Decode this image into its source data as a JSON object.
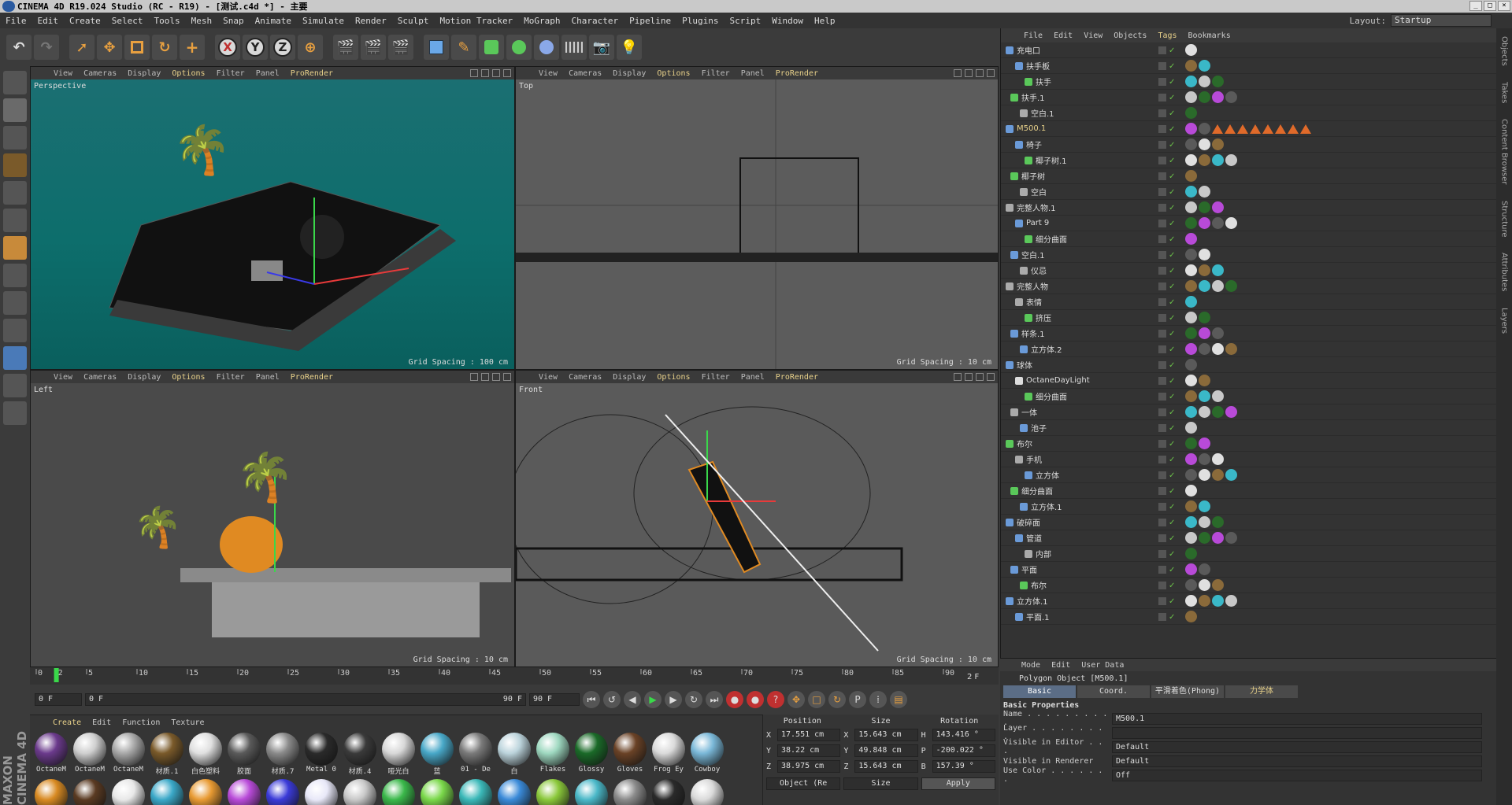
{
  "titlebar": {
    "title": "CINEMA 4D R19.024 Studio (RC - R19) - [测试.c4d *] - 主要"
  },
  "menubar": {
    "items": [
      "File",
      "Edit",
      "Create",
      "Select",
      "Tools",
      "Mesh",
      "Snap",
      "Animate",
      "Simulate",
      "Render",
      "Sculpt",
      "Motion Tracker",
      "MoGraph",
      "Character",
      "Pipeline",
      "Plugins",
      "Script",
      "Window",
      "Help"
    ],
    "layout_label": "Layout:",
    "layout_value": "Startup"
  },
  "viewport_menu": {
    "view": "View",
    "cameras": "Cameras",
    "display": "Display",
    "options": "Options",
    "filter": "Filter",
    "panel": "Panel",
    "prorender": "ProRender"
  },
  "viewports": {
    "perspective": {
      "name": "Perspective",
      "grid": "Grid Spacing : 100 cm"
    },
    "top": {
      "name": "Top",
      "grid": "Grid Spacing : 10 cm"
    },
    "left": {
      "name": "Left",
      "grid": "Grid Spacing : 10 cm"
    },
    "front": {
      "name": "Front",
      "grid": "Grid Spacing : 10 cm"
    }
  },
  "timeline": {
    "ticks": [
      "0",
      "2",
      "5",
      "10",
      "15",
      "20",
      "25",
      "30",
      "35",
      "40",
      "45",
      "50",
      "55",
      "60",
      "65",
      "70",
      "75",
      "80",
      "85",
      "90"
    ],
    "current": "2 F",
    "start": "0 F",
    "range_start": "0 F",
    "range_end": "90 F",
    "end": "90 F"
  },
  "materials": {
    "menu": {
      "create": "Create",
      "edit": "Edit",
      "function": "Function",
      "texture": "Texture"
    },
    "items": [
      {
        "name": "OctaneM",
        "color": "#6b3a8c"
      },
      {
        "name": "OctaneM",
        "color": "#cfcfcf"
      },
      {
        "name": "OctaneM",
        "color": "#a8a8a8"
      },
      {
        "name": "材质.1",
        "color": "#7a5a2a"
      },
      {
        "name": "白色塑料",
        "color": "#e0e0e0"
      },
      {
        "name": "胶面",
        "color": "#5a5a5a"
      },
      {
        "name": "材质.7",
        "color": "#8a8a8a"
      },
      {
        "name": "Metal 0",
        "color": "#2a2a2a"
      },
      {
        "name": "材质.4",
        "color": "#3a3a3a"
      },
      {
        "name": "哑光白",
        "color": "#d8d8d8"
      },
      {
        "name": "蓝",
        "color": "#48a8c8"
      },
      {
        "name": "01 - De",
        "color": "#7a7a7a"
      },
      {
        "name": "白",
        "color": "#bcd4dc"
      },
      {
        "name": "Flakes",
        "color": "#9ed8c0"
      },
      {
        "name": "Glossy",
        "color": "#1a6a28"
      },
      {
        "name": "Gloves",
        "color": "#6a4226"
      },
      {
        "name": "Frog Ey",
        "color": "#dadada"
      },
      {
        "name": "Cowboy",
        "color": "#7ab8d8"
      },
      {
        "name": "",
        "color": "#d88a22"
      },
      {
        "name": "",
        "color": "#5a3a22"
      },
      {
        "name": "",
        "color": "#e8e8e8"
      },
      {
        "name": "",
        "color": "#3aa8c8"
      },
      {
        "name": "",
        "color": "#e89a32"
      },
      {
        "name": "",
        "color": "#b84ad8"
      },
      {
        "name": "",
        "color": "#3a3ad8"
      },
      {
        "name": "",
        "color": "#e8e8f8"
      },
      {
        "name": "",
        "color": "#c8c8c8"
      },
      {
        "name": "",
        "color": "#3ab84a"
      },
      {
        "name": "",
        "color": "#7ad84a"
      },
      {
        "name": "",
        "color": "#3ab8b8"
      },
      {
        "name": "",
        "color": "#3a8ad8"
      },
      {
        "name": "",
        "color": "#8ac83a"
      },
      {
        "name": "",
        "color": "#4ab8c8"
      },
      {
        "name": "",
        "color": "#8a8a8a"
      },
      {
        "name": "",
        "color": "#2a2a2a"
      },
      {
        "name": "",
        "color": "#dadada"
      }
    ]
  },
  "coords": {
    "h_pos": "Position",
    "h_size": "Size",
    "h_rot": "Rotation",
    "x": {
      "label": "X",
      "pos": "17.551 cm",
      "size_label": "X",
      "size": "15.643 cm",
      "rot_label": "H",
      "rot": "143.416 °"
    },
    "y": {
      "label": "Y",
      "pos": "38.22 cm",
      "size_label": "Y",
      "size": "49.848 cm",
      "rot_label": "P",
      "rot": "-200.022 °"
    },
    "z": {
      "label": "Z",
      "pos": "38.975 cm",
      "size_label": "Z",
      "size": "15.643 cm",
      "rot_label": "B",
      "rot": "157.39 °"
    },
    "mode": "Object (Re",
    "size_mode": "Size",
    "apply": "Apply"
  },
  "objects": {
    "menu": [
      "File",
      "Edit",
      "View",
      "Objects",
      "Tags",
      "Bookmarks"
    ],
    "rows": [
      {
        "name": "充电口",
        "icon": "#6a9ad8"
      },
      {
        "name": "扶手板",
        "icon": "#6a9ad8"
      },
      {
        "name": "扶手",
        "icon": "#5ac85a"
      },
      {
        "name": "扶手.1",
        "icon": "#5ac85a"
      },
      {
        "name": "空白.1",
        "icon": "#aaaaaa"
      },
      {
        "name": "M500.1",
        "icon": "#6a9ad8",
        "selected": true
      },
      {
        "name": "椅子",
        "icon": "#6a9ad8"
      },
      {
        "name": "椰子树.1",
        "icon": "#5ac85a"
      },
      {
        "name": "椰子树",
        "icon": "#5ac85a"
      },
      {
        "name": "空白",
        "icon": "#aaaaaa"
      },
      {
        "name": "完整人物.1",
        "icon": "#aaaaaa"
      },
      {
        "name": "Part 9",
        "icon": "#6a9ad8"
      },
      {
        "name": "细分曲面",
        "icon": "#5ac85a"
      },
      {
        "name": "空白.1",
        "icon": "#6a9ad8"
      },
      {
        "name": "仪忌",
        "icon": "#aaaaaa"
      },
      {
        "name": "完整人物",
        "icon": "#aaaaaa"
      },
      {
        "name": "表情",
        "icon": "#aaaaaa"
      },
      {
        "name": "挤压",
        "icon": "#5ac85a"
      },
      {
        "name": "样条.1",
        "icon": "#6a9ad8"
      },
      {
        "name": "立方体.2",
        "icon": "#6a9ad8"
      },
      {
        "name": "球体",
        "icon": "#6a9ad8"
      },
      {
        "name": "OctaneDayLight",
        "icon": "#dddddd"
      },
      {
        "name": "细分曲面",
        "icon": "#5ac85a"
      },
      {
        "name": "一体",
        "icon": "#aaaaaa"
      },
      {
        "name": "池子",
        "icon": "#6a9ad8"
      },
      {
        "name": "布尔",
        "icon": "#5ac85a"
      },
      {
        "name": "手机",
        "icon": "#aaaaaa"
      },
      {
        "name": "立方体",
        "icon": "#6a9ad8"
      },
      {
        "name": "细分曲面",
        "icon": "#5ac85a"
      },
      {
        "name": "立方体.1",
        "icon": "#6a9ad8"
      },
      {
        "name": "破碎面",
        "icon": "#6a9ad8"
      },
      {
        "name": "管道",
        "icon": "#6a9ad8"
      },
      {
        "name": "内部",
        "icon": "#aaaaaa"
      },
      {
        "name": "平面",
        "icon": "#6a9ad8"
      },
      {
        "name": "布尔",
        "icon": "#5ac85a"
      },
      {
        "name": "立方体.1",
        "icon": "#6a9ad8"
      },
      {
        "name": "平面.1",
        "icon": "#6a9ad8"
      }
    ]
  },
  "attributes": {
    "menu": [
      "Mode",
      "Edit",
      "User Data"
    ],
    "title": "Polygon Object [M500.1]",
    "tabs": [
      "Basic",
      "Coord.",
      "平滑着色(Phong)",
      "力学体"
    ],
    "section": "Basic Properties",
    "fields": [
      {
        "label": "Name . . . . . . . . . .",
        "value": "M500.1"
      },
      {
        "label": "Layer . . . . . . . . .",
        "value": ""
      },
      {
        "label": "Visible in Editor . . .",
        "value": "Default"
      },
      {
        "label": "Visible in Renderer",
        "value": "Default"
      },
      {
        "label": "Use Color . . . . . . .",
        "value": "Off"
      }
    ]
  },
  "right_tabs": [
    "Objects",
    "Takes",
    "Content Browser",
    "Structure",
    "Attributes",
    "Layers"
  ]
}
